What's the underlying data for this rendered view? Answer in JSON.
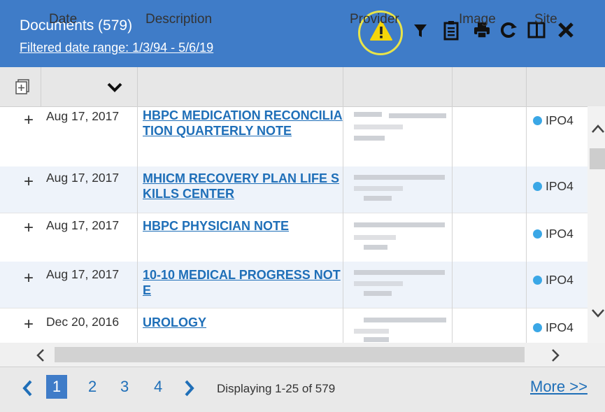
{
  "header": {
    "title": "Documents (579)",
    "filter_link": "Filtered date range: 1/3/94 - 5/6/19",
    "bg_color": "#3f7cc8",
    "toolbar_icons": [
      "warning-icon",
      "filter-icon",
      "clipboard-icon",
      "print-icon",
      "refresh-icon",
      "columns-icon",
      "close-icon"
    ]
  },
  "columns": {
    "date": "Date",
    "description": "Description",
    "provider": "Provider",
    "image": "Image",
    "site": "Site"
  },
  "rows": [
    {
      "date": "Aug 17, 2017",
      "description": "HBPC MEDICATION RECONCILIATION QUARTERLY NOTE",
      "site": "IPO4"
    },
    {
      "date": "Aug 17, 2017",
      "description": "MHICM RECOVERY PLAN LIFE SKILLS CENTER",
      "site": "IPO4"
    },
    {
      "date": "Aug 17, 2017",
      "description": "HBPC PHYSICIAN NOTE",
      "site": "IPO4"
    },
    {
      "date": "Aug 17, 2017",
      "description": "10-10 MEDICAL PROGRESS NOTE",
      "site": "IPO4"
    },
    {
      "date": "Dec 20, 2016",
      "description": "UROLOGY",
      "site": "IPO4"
    }
  ],
  "row_expand_symbol": "+",
  "pagination": {
    "pages": [
      "1",
      "2",
      "3",
      "4"
    ],
    "active_page": "1",
    "display_text": "Displaying 1-25 of 579",
    "more_link": "More >>"
  }
}
